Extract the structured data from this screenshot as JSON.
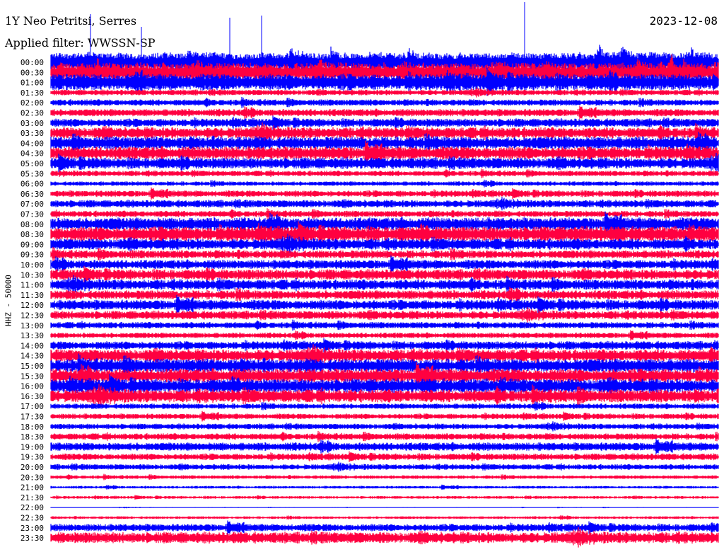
{
  "header": {
    "station": "1Y Neo Petritsi, Serres",
    "filter": "Applied filter: WWSSN-SP",
    "date": "2023-12-08"
  },
  "chart_data": {
    "type": "helicorder",
    "title": "1Y Neo Petritsi, Serres",
    "ylabel": "HHZ - 50000",
    "row_minutes": 30,
    "colors": [
      "#0000ff",
      "#ff0040"
    ],
    "rows": [
      {
        "label": "00:00",
        "amp": 1.0
      },
      {
        "label": "00:30",
        "amp": 1.0
      },
      {
        "label": "01:00",
        "amp": 0.9
      },
      {
        "label": "01:30",
        "amp": 0.3
      },
      {
        "label": "02:00",
        "amp": 0.35
      },
      {
        "label": "02:30",
        "amp": 0.4
      },
      {
        "label": "03:00",
        "amp": 0.45
      },
      {
        "label": "03:30",
        "amp": 0.6
      },
      {
        "label": "04:00",
        "amp": 0.7
      },
      {
        "label": "04:30",
        "amp": 0.7
      },
      {
        "label": "05:00",
        "amp": 0.6
      },
      {
        "label": "05:30",
        "amp": 0.3
      },
      {
        "label": "06:00",
        "amp": 0.25
      },
      {
        "label": "06:30",
        "amp": 0.35
      },
      {
        "label": "07:00",
        "amp": 0.4
      },
      {
        "label": "07:30",
        "amp": 0.35
      },
      {
        "label": "08:00",
        "amp": 0.7
      },
      {
        "label": "08:30",
        "amp": 0.8
      },
      {
        "label": "09:00",
        "amp": 0.6
      },
      {
        "label": "09:30",
        "amp": 0.45
      },
      {
        "label": "10:00",
        "amp": 0.5
      },
      {
        "label": "10:30",
        "amp": 0.55
      },
      {
        "label": "11:00",
        "amp": 0.55
      },
      {
        "label": "11:30",
        "amp": 0.5
      },
      {
        "label": "12:00",
        "amp": 0.55
      },
      {
        "label": "12:30",
        "amp": 0.45
      },
      {
        "label": "13:00",
        "amp": 0.35
      },
      {
        "label": "13:30",
        "amp": 0.3
      },
      {
        "label": "14:00",
        "amp": 0.45
      },
      {
        "label": "14:30",
        "amp": 0.65
      },
      {
        "label": "15:00",
        "amp": 0.75
      },
      {
        "label": "15:30",
        "amp": 0.75
      },
      {
        "label": "16:00",
        "amp": 0.75
      },
      {
        "label": "16:30",
        "amp": 0.7
      },
      {
        "label": "17:00",
        "amp": 0.3
      },
      {
        "label": "17:30",
        "amp": 0.3
      },
      {
        "label": "18:00",
        "amp": 0.3
      },
      {
        "label": "18:30",
        "amp": 0.35
      },
      {
        "label": "19:00",
        "amp": 0.45
      },
      {
        "label": "19:30",
        "amp": 0.35
      },
      {
        "label": "20:00",
        "amp": 0.3
      },
      {
        "label": "20:30",
        "amp": 0.2
      },
      {
        "label": "21:00",
        "amp": 0.15
      },
      {
        "label": "21:30",
        "amp": 0.15
      },
      {
        "label": "22:00",
        "amp": 0.05
      },
      {
        "label": "22:30",
        "amp": 0.15
      },
      {
        "label": "23:00",
        "amp": 0.4
      },
      {
        "label": "23:30",
        "amp": 0.6
      }
    ]
  }
}
